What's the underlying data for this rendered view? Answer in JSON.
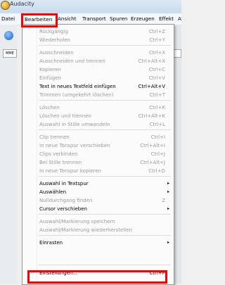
{
  "app": {
    "title": "Audacity"
  },
  "menubar": {
    "items": [
      "Datei",
      "Bearbeiten",
      "Ansicht",
      "Transport",
      "Spuren",
      "Erzeugen",
      "Effekt",
      "A"
    ],
    "active": "Bearbeiten"
  },
  "toolbar": {
    "meter_label": "MME"
  },
  "edit_menu": {
    "items": [
      {
        "label": "Rückgängig",
        "shortcut": "Ctrl+Z",
        "enabled": false
      },
      {
        "label": "Wiederholen",
        "shortcut": "Ctrl+Y",
        "enabled": false
      },
      {
        "label": "Ausschneiden",
        "shortcut": "Ctrl+X",
        "enabled": false
      },
      {
        "label": "Ausschneiden und trennen",
        "shortcut": "Ctrl+Alt+X",
        "enabled": false
      },
      {
        "label": "Kopieren",
        "shortcut": "Ctrl+C",
        "enabled": false
      },
      {
        "label": "Einfügen",
        "shortcut": "Ctrl+V",
        "enabled": false
      },
      {
        "label": "Text in neues Textfeld einfügen",
        "shortcut": "Ctrl+Alt+V",
        "enabled": true
      },
      {
        "label": "Trimmen (umgekehrt löschen)",
        "shortcut": "Ctrl+T",
        "enabled": false
      },
      {
        "label": "Löschen",
        "shortcut": "Ctrl+K",
        "enabled": false
      },
      {
        "label": "Löschen und trennen",
        "shortcut": "Ctrl+Alt+K",
        "enabled": false
      },
      {
        "label": "Auswahl in Stille umwandeln",
        "shortcut": "Ctrl+L",
        "enabled": false
      },
      {
        "label": "Clip trennen",
        "shortcut": "Ctrl+I",
        "enabled": false
      },
      {
        "label": "In neue Tonspur verschieben",
        "shortcut": "Ctrl+Alt+I",
        "enabled": false
      },
      {
        "label": "Clips verbinden",
        "shortcut": "Ctrl+J",
        "enabled": false
      },
      {
        "label": "Bei Stille trennen",
        "shortcut": "Ctrl+Alt+J",
        "enabled": false
      },
      {
        "label": "In neue Tonspur kopieren",
        "shortcut": "Ctrl+D",
        "enabled": false
      },
      {
        "label": "Auswahl in Textspur",
        "shortcut": "",
        "enabled": true,
        "submenu": true
      },
      {
        "label": "Auswählen",
        "shortcut": "",
        "enabled": true,
        "submenu": true
      },
      {
        "label": "Nulldurchgang finden",
        "shortcut": "Z",
        "enabled": false
      },
      {
        "label": "Cursor verschieben",
        "shortcut": "",
        "enabled": true,
        "submenu": true
      },
      {
        "label": "Auswahl/Markierung speichern",
        "shortcut": "",
        "enabled": false
      },
      {
        "label": "Auswahl/Markierung wiederherstellen",
        "shortcut": "",
        "enabled": false
      },
      {
        "label": "Einrasten",
        "shortcut": "",
        "enabled": true,
        "submenu": true
      },
      {
        "label": "Einstellungen...",
        "shortcut": "Ctrl+P",
        "enabled": true
      }
    ],
    "submenu_arrow": "▸"
  },
  "highlight_color": "#ff0000"
}
